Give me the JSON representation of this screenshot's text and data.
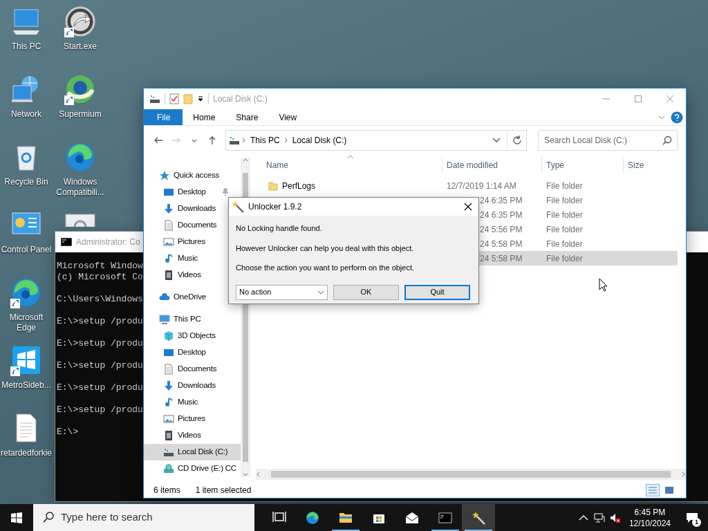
{
  "desktop": {
    "columns": [
      [
        {
          "label": "This PC",
          "kind": "computer",
          "shortcut": false
        },
        {
          "label": "Network",
          "kind": "network",
          "shortcut": false
        },
        {
          "label": "Recycle Bin",
          "kind": "recycle",
          "shortcut": false
        },
        {
          "label": "Control Panel",
          "kind": "controlpanel",
          "shortcut": false
        },
        {
          "label": "Microsoft Edge",
          "kind": "edge",
          "shortcut": true
        },
        {
          "label": "MetroSideb...",
          "kind": "tiles",
          "shortcut": true
        },
        {
          "label": "retardedforkie",
          "kind": "document",
          "shortcut": false
        }
      ],
      [
        {
          "label": "Start.exe",
          "kind": "launcher",
          "shortcut": true
        },
        {
          "label": "Supermium",
          "kind": "browser",
          "shortcut": true
        },
        {
          "label": "Windows Compatibili...",
          "kind": "edge",
          "shortcut": false
        },
        {
          "kind": "settings"
        }
      ]
    ]
  },
  "console": {
    "title": "Administrator: Co",
    "blocks": [
      [
        "Microsoft Window",
        "(c) Microsoft Co"
      ],
      [
        "C:\\Users\\Windows"
      ],
      [
        "E:\\>setup /produ"
      ],
      [
        "E:\\>setup /produ"
      ],
      [
        "E:\\>setup /produ"
      ],
      [
        "E:\\>setup /produ"
      ],
      [
        "E:\\>setup /produ"
      ],
      [
        "E:\\>"
      ]
    ]
  },
  "explorer": {
    "title": "Local Disk (C:)",
    "ribbon_tabs": [
      {
        "label": "File",
        "kind": "file"
      },
      {
        "label": "Home",
        "kind": "tab"
      },
      {
        "label": "Share",
        "kind": "tab"
      },
      {
        "label": "View",
        "kind": "tab"
      }
    ],
    "breadcrumb": [
      "This PC",
      "Local Disk (C:)"
    ],
    "search": {
      "placeholder": "Search Local Disk (C:)"
    },
    "nav": [
      {
        "label": "Quick access",
        "kind": "star",
        "pinned": false,
        "selected": false,
        "children": [
          {
            "label": "Desktop",
            "kind": "desktop",
            "pinned": true,
            "selected": false
          },
          {
            "label": "Downloads",
            "kind": "download",
            "pinned": false,
            "selected": false
          },
          {
            "label": "Documents",
            "kind": "document",
            "pinned": false,
            "selected": false
          },
          {
            "label": "Pictures",
            "kind": "picture",
            "pinned": false,
            "selected": false
          },
          {
            "label": "Music",
            "kind": "music",
            "pinned": false,
            "selected": false
          },
          {
            "label": "Videos",
            "kind": "video",
            "pinned": false,
            "selected": false
          }
        ]
      },
      {
        "label": "OneDrive",
        "kind": "cloud",
        "pinned": false,
        "selected": false
      },
      {
        "label": "This PC",
        "kind": "computer",
        "pinned": false,
        "selected": false,
        "children": [
          {
            "label": "3D Objects",
            "kind": "cube",
            "pinned": false,
            "selected": false
          },
          {
            "label": "Desktop",
            "kind": "desktop",
            "pinned": false,
            "selected": false
          },
          {
            "label": "Documents",
            "kind": "document",
            "pinned": false,
            "selected": false
          },
          {
            "label": "Downloads",
            "kind": "download",
            "pinned": false,
            "selected": false
          },
          {
            "label": "Music",
            "kind": "music",
            "pinned": false,
            "selected": false
          },
          {
            "label": "Pictures",
            "kind": "picture",
            "pinned": false,
            "selected": false
          },
          {
            "label": "Videos",
            "kind": "video",
            "pinned": false,
            "selected": false
          },
          {
            "label": "Local Disk (C:)",
            "kind": "drive",
            "pinned": false,
            "selected": true
          },
          {
            "label": "CD Drive (E:) CC",
            "kind": "cd",
            "pinned": false,
            "selected": false
          }
        ]
      }
    ],
    "columns": [
      "Name",
      "Date modified",
      "Type",
      "Size"
    ],
    "rows": [
      {
        "name": "PerfLogs",
        "date": "12/7/2019 1:14 AM",
        "type": "File folder",
        "selected": false
      },
      {
        "date": "24 6:35 PM",
        "type": "File folder",
        "selected": false
      },
      {
        "date": "24 6:35 PM",
        "type": "File folder",
        "selected": false
      },
      {
        "date": "24 5:56 PM",
        "type": "File folder",
        "selected": false
      },
      {
        "date": "24 5:58 PM",
        "type": "File folder",
        "selected": false
      },
      {
        "date": "24 5:58 PM",
        "type": "File folder",
        "selected": true
      }
    ],
    "status": {
      "count": "6 items",
      "selection": "1 item selected"
    }
  },
  "dialog": {
    "title": "Unlocker 1.9.2",
    "messages": [
      "No Locking handle found.",
      "However Unlocker can help you deal with this object.",
      "Choose the action you want to perform on the object."
    ],
    "action": "No action",
    "buttons": [
      {
        "label": "OK",
        "focused": false
      },
      {
        "label": "Quit",
        "focused": true
      }
    ]
  },
  "taskbar": {
    "search": {
      "placeholder": "Type here to search"
    },
    "apps": [
      {
        "kind": "taskview",
        "running": false,
        "active": false
      },
      {
        "kind": "edge",
        "running": false,
        "active": false
      },
      {
        "kind": "explorer",
        "running": true,
        "active": false
      },
      {
        "kind": "store",
        "running": false,
        "active": false
      },
      {
        "kind": "mail",
        "running": false,
        "active": false
      },
      {
        "kind": "cmd",
        "running": true,
        "active": false
      },
      {
        "kind": "unlocker",
        "running": true,
        "active": true
      }
    ],
    "time": "6:45 PM",
    "date": "12/10/2024",
    "notifications": "1"
  }
}
